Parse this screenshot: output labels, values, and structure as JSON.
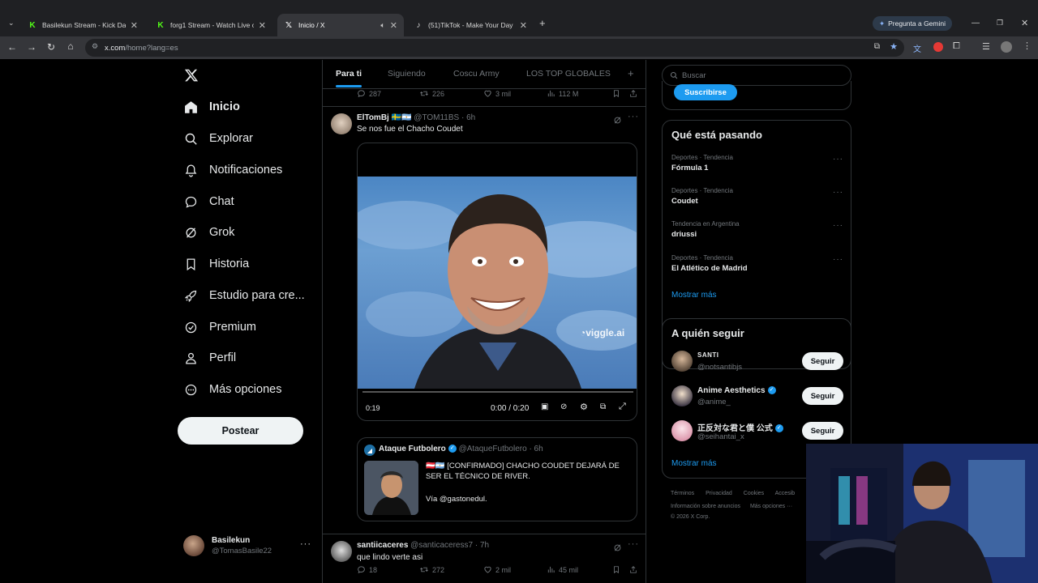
{
  "browser": {
    "tabs": [
      {
        "title": "Basilekun Stream - Kick Dashbo",
        "favicon": "K",
        "color": "#53fc18"
      },
      {
        "title": "forg1 Stream - Watch Live on K",
        "favicon": "K",
        "color": "#53fc18"
      },
      {
        "title": "Inicio / X",
        "favicon": "X",
        "color": "#ffffff"
      },
      {
        "title": "(51)TikTok - Make Your Day",
        "favicon": "♪",
        "color": "#ffffff"
      }
    ],
    "url_host": "x.com",
    "url_path": "/home?lang=es",
    "gemini_label": "Pregunta a Gemini"
  },
  "sidebar": {
    "items": [
      {
        "label": "Inicio",
        "icon": "home-icon"
      },
      {
        "label": "Explorar",
        "icon": "search-icon"
      },
      {
        "label": "Notificaciones",
        "icon": "bell-icon"
      },
      {
        "label": "Chat",
        "icon": "chat-icon"
      },
      {
        "label": "Grok",
        "icon": "grok-icon"
      },
      {
        "label": "Historia",
        "icon": "bookmark-icon"
      },
      {
        "label": "Estudio para cre...",
        "icon": "rocket-icon"
      },
      {
        "label": "Premium",
        "icon": "verified-icon"
      },
      {
        "label": "Perfil",
        "icon": "person-icon"
      },
      {
        "label": "Más opciones",
        "icon": "more-circle-icon"
      }
    ],
    "post_label": "Postear",
    "account": {
      "name": "Basilekun",
      "handle": "@TomasBasile22"
    }
  },
  "feed": {
    "tabs": [
      "Para ti",
      "Siguiendo",
      "Coscu Army",
      "LOS TOP GLOBALES"
    ],
    "prev_actions": {
      "replies": "287",
      "reposts": "226",
      "likes": "3 mil",
      "views": "112 M"
    },
    "tweet": {
      "name": "ElTomBj",
      "flags": "🇸🇪🇦🇷",
      "handle": "@TOM11BS",
      "time": "· 6h",
      "text": "Se nos fue el Chacho Coudet",
      "video_watermark": "viggle.ai",
      "video_remaining": "0:19",
      "video_time": "0:00 / 0:20",
      "quote": {
        "name": "Ataque Futbolero",
        "handle": "@AtaqueFutbolero",
        "time": "· 6h",
        "text": "[CONFIRMADO] CHACHO COUDET DEJARÁ DE SER EL TÉCNICO DE RIVER.",
        "via": "Vía @gastonedul."
      },
      "actions": {
        "replies": "18",
        "reposts": "272",
        "likes": "2 mil",
        "views": "45 mil"
      }
    },
    "next_tweet": {
      "name": "santiicaceres",
      "handle": "@santicaceress7",
      "time": "· 7h",
      "text": "que lindo verte asi"
    }
  },
  "right": {
    "search_placeholder": "Buscar",
    "subscribe_label": "Suscribirse",
    "trending_title": "Qué está pasando",
    "trends": [
      {
        "meta": "Deportes · Tendencia",
        "name": "Fórmula 1"
      },
      {
        "meta": "Deportes · Tendencia",
        "name": "Coudet"
      },
      {
        "meta": "Tendencia en Argentina",
        "name": "driussi"
      },
      {
        "meta": "Deportes · Tendencia",
        "name": "El Atlético de Madrid"
      }
    ],
    "show_more": "Mostrar más",
    "follow_title": "A quién seguir",
    "follows": [
      {
        "name": "SANTI",
        "handle": "@notsantibjs",
        "verified": false
      },
      {
        "name": "Anime Aesthetics",
        "handle": "@anime_",
        "verified": true
      },
      {
        "name": "正反対な君と僕 公式",
        "handle": "@seihantai_x",
        "verified": true
      }
    ],
    "follow_btn": "Seguir",
    "footer": {
      "l1": [
        "Términos",
        "Privacidad",
        "Cookies",
        "Accesib"
      ],
      "l2": [
        "Información sobre anuncios",
        "Más opciones ···"
      ],
      "l3": "© 2026 X Corp."
    }
  }
}
